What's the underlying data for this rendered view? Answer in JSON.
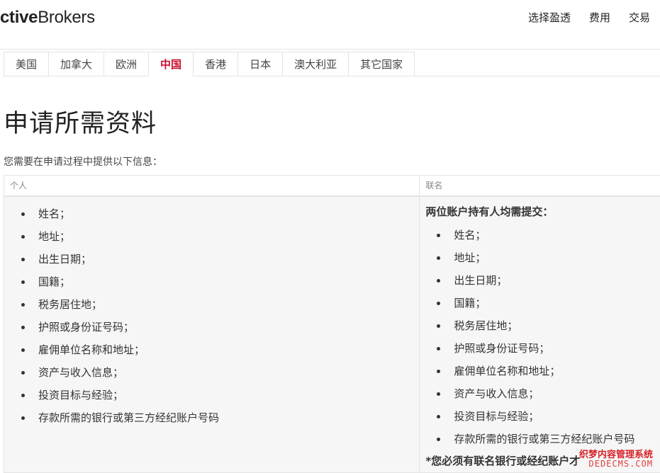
{
  "header": {
    "logo_prefix": "ctive",
    "logo_suffix": "Brokers",
    "nav": [
      "选择盈透",
      "费用",
      "交易"
    ]
  },
  "tabs": [
    {
      "label": "美国",
      "active": false
    },
    {
      "label": "加拿大",
      "active": false
    },
    {
      "label": "欧洲",
      "active": false
    },
    {
      "label": "中国",
      "active": true
    },
    {
      "label": "香港",
      "active": false
    },
    {
      "label": "日本",
      "active": false
    },
    {
      "label": "澳大利亚",
      "active": false
    },
    {
      "label": "其它国家",
      "active": false
    }
  ],
  "page": {
    "title": "申请所需资料",
    "intro": "您需要在申请过程中提供以下信息："
  },
  "table": {
    "individual": {
      "header": "个人",
      "items": [
        "姓名；",
        "地址；",
        "出生日期；",
        "国籍；",
        "税务居住地；",
        "护照或身份证号码；",
        "雇佣单位名称和地址；",
        "资产与收入信息；",
        "投资目标与经验；",
        "存款所需的银行或第三方经纪账户号码"
      ]
    },
    "joint": {
      "header": "联名",
      "subheader": "两位账户持有人均需提交：",
      "items": [
        "姓名；",
        "地址；",
        "出生日期；",
        "国籍；",
        "税务居住地；",
        "护照或身份证号码；",
        "雇佣单位名称和地址；",
        "资产与收入信息；",
        "投资目标与经验；",
        "存款所需的银行或第三方经纪账户号码"
      ],
      "footnote": "*您必须有联名银行或经纪账户才"
    }
  },
  "watermark": {
    "line1": "织梦内容管理系统",
    "line2": "DEDECMS.COM"
  },
  "colors": {
    "active_tab": "#c8102e",
    "border": "#e3e3e3",
    "panel_bg": "#f6f6f6"
  }
}
